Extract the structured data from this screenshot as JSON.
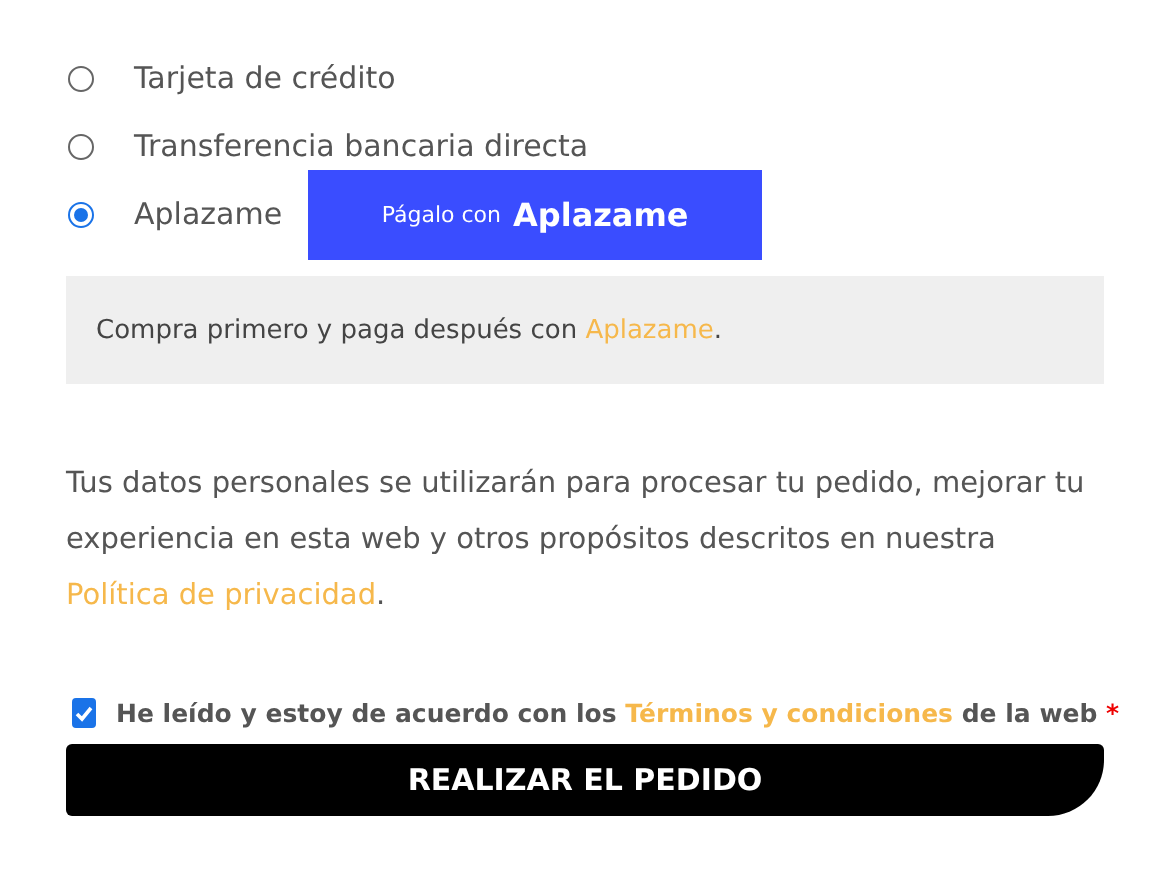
{
  "payment_methods": [
    {
      "label": "Tarjeta de crédito",
      "selected": false
    },
    {
      "label": "Transferencia bancaria directa",
      "selected": false
    },
    {
      "label": "Aplazame",
      "selected": true,
      "pay_button": {
        "prefix": "Págalo con",
        "brand": "Aplazame"
      }
    }
  ],
  "notice": {
    "text": "Compra primero y paga después con ",
    "link": "Aplazame",
    "after": "."
  },
  "privacy": {
    "text": "Tus datos personales se utilizarán para procesar tu pedido, mejorar tu experiencia en esta web y otros propósitos descritos en nuestra ",
    "link": "Política de privacidad",
    "after": "."
  },
  "terms": {
    "checked": true,
    "text": "He leído y estoy de acuerdo con los ",
    "link": "Términos y condiciones",
    "after": " de la web ",
    "required": "*"
  },
  "submit": "REALIZAR EL PEDIDO"
}
